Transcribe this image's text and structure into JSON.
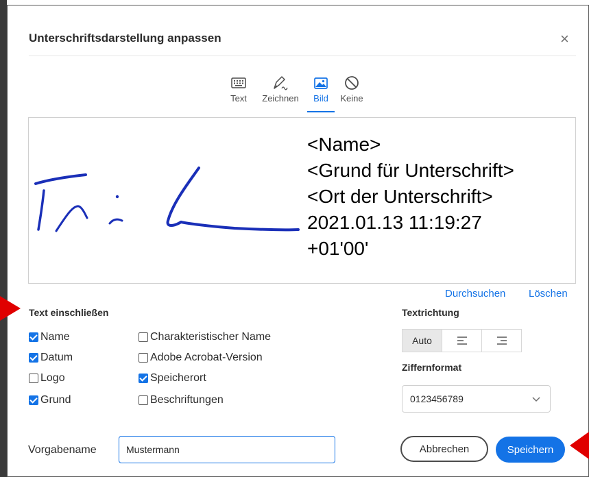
{
  "dialog": {
    "title": "Unterschriftsdarstellung anpassen",
    "close_label": "×"
  },
  "tabs": [
    {
      "label": "Text",
      "icon": "keyboard-icon",
      "active": false
    },
    {
      "label": "Zeichnen",
      "icon": "pen-icon",
      "active": false
    },
    {
      "label": "Bild",
      "icon": "image-icon",
      "active": true
    },
    {
      "label": "Keine",
      "icon": "none-icon",
      "active": false
    }
  ],
  "preview": {
    "lines": [
      "<Name>",
      "<Grund für Unterschrift>",
      "<Ort der Unterschrift>",
      "2021.01.13 11:19:27",
      "+01'00'"
    ],
    "ink_color": "#1a2fb8"
  },
  "links": {
    "browse": "Durchsuchen",
    "delete": "Löschen"
  },
  "include_text": {
    "label": "Text einschließen",
    "options": [
      {
        "label": "Name",
        "checked": true
      },
      {
        "label": "Charakteristischer Name",
        "checked": false
      },
      {
        "label": "Datum",
        "checked": true
      },
      {
        "label": "Adobe Acrobat-Version",
        "checked": false
      },
      {
        "label": "Logo",
        "checked": false
      },
      {
        "label": "Speicherort",
        "checked": true
      },
      {
        "label": "Grund",
        "checked": true
      },
      {
        "label": "Beschriftungen",
        "checked": false
      }
    ]
  },
  "text_direction": {
    "label": "Textrichtung",
    "options": [
      "Auto",
      "align-left-icon",
      "align-right-icon"
    ],
    "selected": "Auto"
  },
  "number_format": {
    "label": "Ziffernformat",
    "value": "0123456789"
  },
  "preset": {
    "label": "Vorgabename",
    "value": "Mustermann"
  },
  "buttons": {
    "cancel": "Abbrechen",
    "save": "Speichern"
  },
  "colors": {
    "accent": "#1473e6",
    "annotation_arrow": "#e00000"
  }
}
